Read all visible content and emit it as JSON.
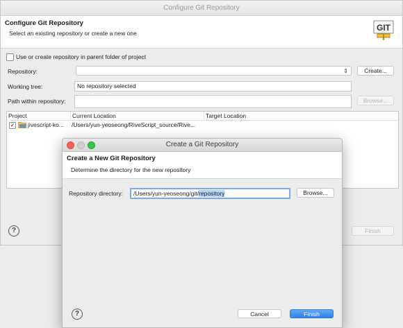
{
  "outer": {
    "window_title": "Configure Git Repository",
    "header_title": "Configure Git Repository",
    "header_desc": "Select an existing repository or create a new one",
    "logo_text": "GIT",
    "parent_checkbox_label": "Use or create repository in parent folder of project",
    "repository_label": "Repository:",
    "create_button": "Create...",
    "working_tree_label": "Working tree:",
    "working_tree_value": "No repository selected",
    "path_label": "Path within repository:",
    "browse_button": "Browse...",
    "table": {
      "headers": [
        "Project",
        "Current Location",
        "Target Location"
      ],
      "rows": [
        {
          "project": "jivescript-ko...",
          "current": "/Users/yun-yeoseong/RiveScript_source/Rive...",
          "target": ""
        }
      ]
    },
    "finish_button": "Finish"
  },
  "inner": {
    "window_title": "Create a Git Repository",
    "header_title": "Create a New Git Repository",
    "header_desc": "Determine the directory for the new repository",
    "dir_label": "Repository directory:",
    "dir_value_prefix": "/Users/yun-yeoseong/git/",
    "dir_value_selected": "repository",
    "browse_button": "Browse...",
    "cancel_button": "Cancel",
    "finish_button": "Finish"
  },
  "colors": {
    "accent": "#2f7fe9",
    "selection": "#b3d4fc",
    "traffic_close": "#fc605b",
    "traffic_min": "#fdbc40",
    "traffic_max": "#34c84a"
  }
}
